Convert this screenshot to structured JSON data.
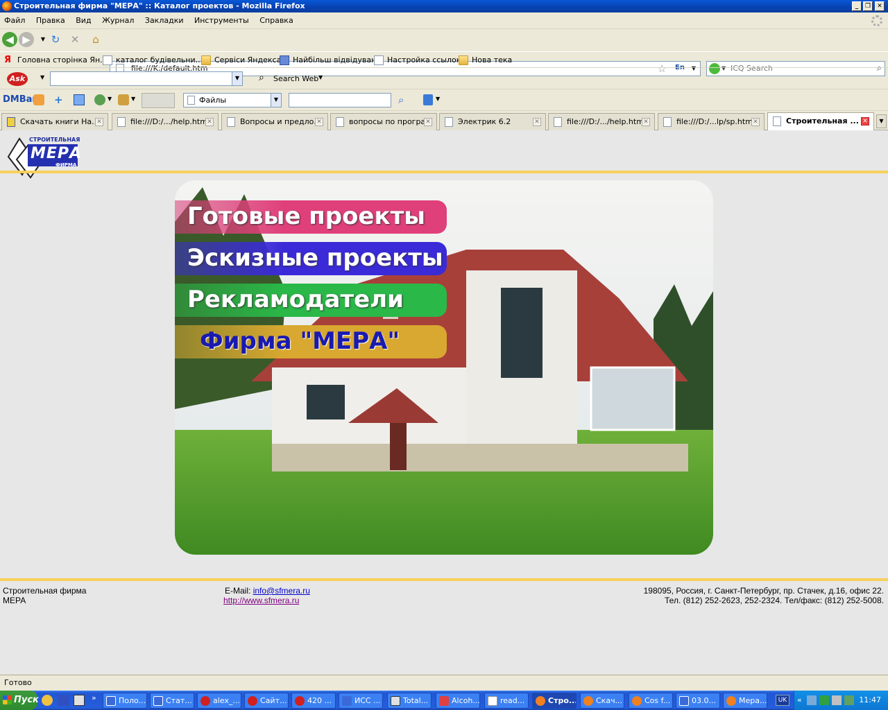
{
  "window": {
    "title": "Строительная фирма \"МЕРА\" :: Каталог проектов - Mozilla Firefox"
  },
  "menu": [
    "Файл",
    "Правка",
    "Вид",
    "Журнал",
    "Закладки",
    "Инструменты",
    "Справка"
  ],
  "address": {
    "url": "file:///K:/default.htm",
    "lang": "En"
  },
  "search": {
    "placeholder": "ICQ Search"
  },
  "bookmarks": [
    {
      "label": "Головна сторінка Ян...",
      "icon": "yandex-icon"
    },
    {
      "label": "каталог будівельни...",
      "icon": "page-icon"
    },
    {
      "label": "Сервіси Яндекса",
      "icon": "folder-icon"
    },
    {
      "label": "Найбільш відвідувані",
      "icon": "smart-folder-icon"
    },
    {
      "label": "Настройка ссылок",
      "icon": "page-icon"
    },
    {
      "label": "Нова тека",
      "icon": "folder-icon"
    }
  ],
  "ask": {
    "search_web": "Search Web"
  },
  "dmbar": {
    "label": "DMBar",
    "combo_value": "Файлы"
  },
  "tabs": [
    {
      "label": "Скачать книги На...",
      "active": false
    },
    {
      "label": "file:///D:/.../help.html",
      "active": false
    },
    {
      "label": "Вопросы и предло...",
      "active": false
    },
    {
      "label": "вопросы по програ...",
      "active": false
    },
    {
      "label": "Электрик 6.2",
      "active": false
    },
    {
      "label": "file:///D:/.../help.html",
      "active": false
    },
    {
      "label": "file:///D:/...lp/sp.html",
      "active": false
    },
    {
      "label": "Строительная ...",
      "active": true
    }
  ],
  "site": {
    "logo_top": "СТРОИТЕЛЬНАЯ",
    "logo_main": "МЕРА",
    "logo_bottom": "ФИРМА",
    "menu": [
      {
        "label": "Готовые проекты",
        "color": "#e0407a"
      },
      {
        "label": "Эскизные проекты",
        "color": "#3a2ad8"
      },
      {
        "label": "Рекламодатели",
        "color": "#2ab848"
      },
      {
        "label": "Фирма \"МЕРА\"",
        "color": "#d8a830"
      }
    ],
    "footer": {
      "company_line1": "Строительная фирма",
      "company_line2": "МЕРА",
      "email_label": "E-Mail:",
      "email": "info@sfmera.ru",
      "website": "http://www.sfmera.ru",
      "address": "198095, Россия, г. Санкт-Петербург, пр. Стачек, д.16, офис 22.",
      "phones": "Тел. (812) 252-2623, 252-2324. Тел/факс: (812) 252-5008."
    }
  },
  "status": {
    "text": "Готово"
  },
  "taskbar": {
    "start": "Пуск",
    "tasks": [
      "Поло...",
      "Стат...",
      "alex_...",
      "Сайт...",
      "420 ...",
      "ИСС ...",
      "Total...",
      "Alcoh...",
      "read...",
      "Стро...",
      "Скач...",
      "Cos f...",
      "03.0...",
      "Мера..."
    ],
    "active_index": 9,
    "lang": "UK",
    "time": "11:47"
  }
}
